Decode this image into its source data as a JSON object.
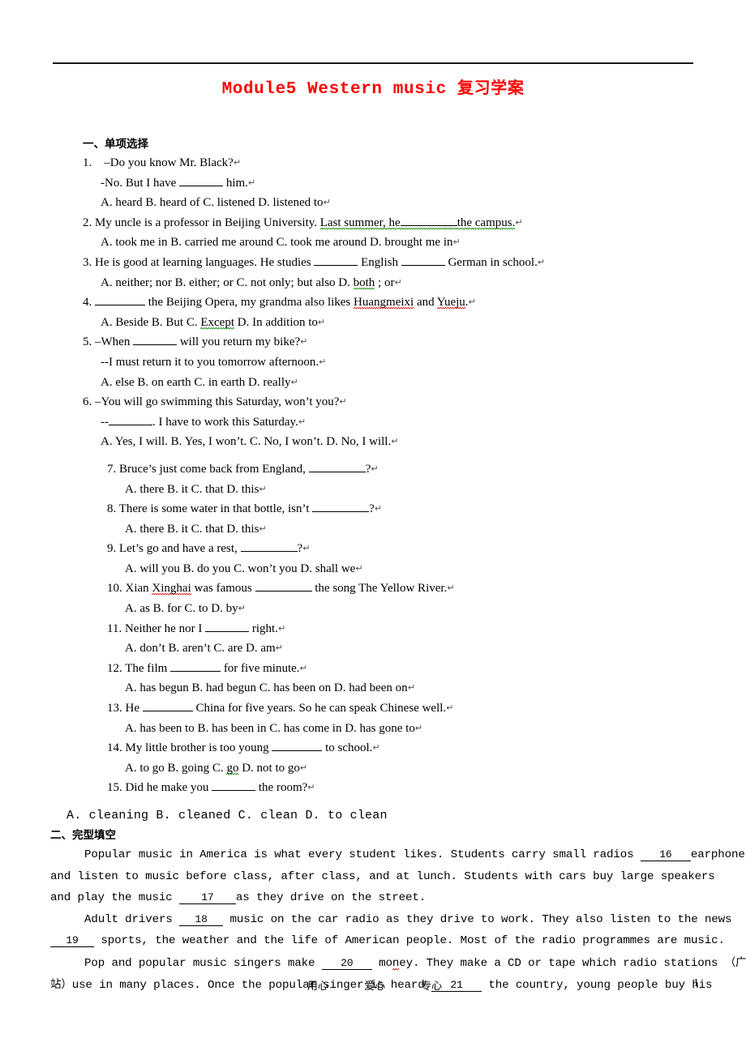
{
  "document": {
    "title_en": "Module5 Western music",
    "title_cn": "复习学案",
    "title_color": "#ff0000"
  },
  "section1": {
    "heading": "一、单项选择",
    "questions": [
      {
        "num": "1.",
        "lines": [
          "–Do you know Mr. Black?",
          "-No. But I have ______ him."
        ],
        "options": "A. heard        B. heard of        C. listened          D. listened to"
      },
      {
        "num": "2.",
        "stem_a": "My uncle is a professor in Beijing University. ",
        "stem_flag": "Last summer, he ________ the campus.",
        "options": "A. took me in        B. carried me around        C. took me around        D. brought me in"
      },
      {
        "num": "3.",
        "stem": "He is good at learning languages. He studies ______ English ______ German in school.",
        "options_a": "A. neither; nor          B. either; or         C. not only; but also        D. ",
        "options_flag": "both",
        "options_b": " ; or"
      },
      {
        "num": "4.",
        "stem_a": "______ the Beijing Opera, my grandma also likes ",
        "stem_w1": "Huangmeixi",
        "stem_mid": " and ",
        "stem_w2": "Yueju",
        "stem_end": ".",
        "options_a": "A. Beside         B. But        C. ",
        "options_flag": "Except",
        "options_b": "         D. In addition to"
      },
      {
        "num": "5.",
        "lines": [
          "–When ______ will you return my bike?",
          "--I must return it to you tomorrow afternoon."
        ],
        "options": "A. else      B. on earth       C. in earth       D. really"
      },
      {
        "num": "6.",
        "lines": [
          "–You will go swimming this Saturday, won’t you?",
          "--______. I have to work this Saturday."
        ],
        "options": "A. Yes, I will.        B. Yes, I won’t.       C. No, I won’t.          D. No, I will."
      },
      {
        "num": "7.",
        "stem": "Bruce’s just come back from England, _______?",
        "options": "A. there        B. it         C. that         D. this"
      },
      {
        "num": "8.",
        "stem": "There is some water in that bottle, isn’t _______?",
        "options": "A. there        B. it        C. that        D. this"
      },
      {
        "num": "9.",
        "stem": "Let’s go and have a rest, _______?",
        "options": "A. will you        B. do you         C. won’t you        D. shall we"
      },
      {
        "num": "10.",
        "stem_a": "Xian ",
        "stem_flag": "Xinghai",
        "stem_b": " was famous _______ the song The Yellow River.",
        "options": "A. as          B. for          C. to         D. by"
      },
      {
        "num": "11.",
        "stem": "Neither he nor I ______ right.",
        "options": "A. don’t        B. aren’t         C. are        D. am"
      },
      {
        "num": "12.",
        "stem": "The film ______ for five minute.",
        "options": "A. has begun        B. had begun         C. has been on        D. had been on"
      },
      {
        "num": "13.",
        "stem": "He ______ China for five years. So he can speak Chinese well.",
        "options": "A. has been to         B. has been in          C. has come in         D. has gone to"
      },
      {
        "num": "14.",
        "stem": "My little brother is too young ______ to school.",
        "options_a": "A. to go       B. going        C. ",
        "options_flag": "go",
        "options_b": "        D. not to go"
      },
      {
        "num": "15.",
        "stem": "Did he make you ______ the room?",
        "options": ""
      }
    ],
    "q15_answers": "A. cleaning    B. cleaned    C. clean    D. to clean"
  },
  "section2": {
    "heading": "二、完型填空",
    "paragraphs": [
      {
        "lines": [
          {
            "indent": true,
            "parts": [
              {
                "t": "Popular music in America is what every student likes. Students carry small radios "
              },
              {
                "blank": "16",
                "w": "w3"
              },
              {
                "t": "earphones"
              }
            ]
          },
          {
            "indent": false,
            "parts": [
              {
                "t": "and listen to music before class, after class, and at lunch. Students with cars buy large speakers"
              }
            ]
          },
          {
            "indent": false,
            "parts": [
              {
                "t": "and play the music "
              },
              {
                "blank": "17",
                "w": "w4"
              },
              {
                "t": "as they drive on the street."
              }
            ]
          }
        ]
      },
      {
        "lines": [
          {
            "indent": true,
            "parts": [
              {
                "t": "Adult drivers "
              },
              {
                "blank": "18",
                "w": "w2"
              },
              {
                "t": " music on the car radio as they drive to work. They also listen to the news"
              }
            ]
          },
          {
            "indent": false,
            "parts": [
              {
                "blank": "19",
                "w": "w2"
              },
              {
                "t": " sports, the weather and the life of American people. Most of the radio programmes are music."
              }
            ]
          }
        ]
      },
      {
        "lines": [
          {
            "indent": true,
            "parts": [
              {
                "t": "Pop and popular music singers make "
              },
              {
                "blank": "20",
                "w": "w3"
              },
              {
                "t": " mo"
              },
              {
                "flag": "n"
              },
              {
                "t": "ey. They make a CD or tape which radio stations ("
              },
              {
                "cn": "广播"
              }
            ]
          },
          {
            "indent": false,
            "parts": [
              {
                "cn": "站"
              },
              {
                "t": ") use in many places. Once the popular singer is heard "
              },
              {
                "blank": "21",
                "w": "w3"
              },
              {
                "t": " the country, young people buy his"
              }
            ]
          }
        ]
      }
    ]
  },
  "footer": {
    "words": [
      "用心",
      "爱心",
      "专心"
    ],
    "page_number": "1"
  }
}
